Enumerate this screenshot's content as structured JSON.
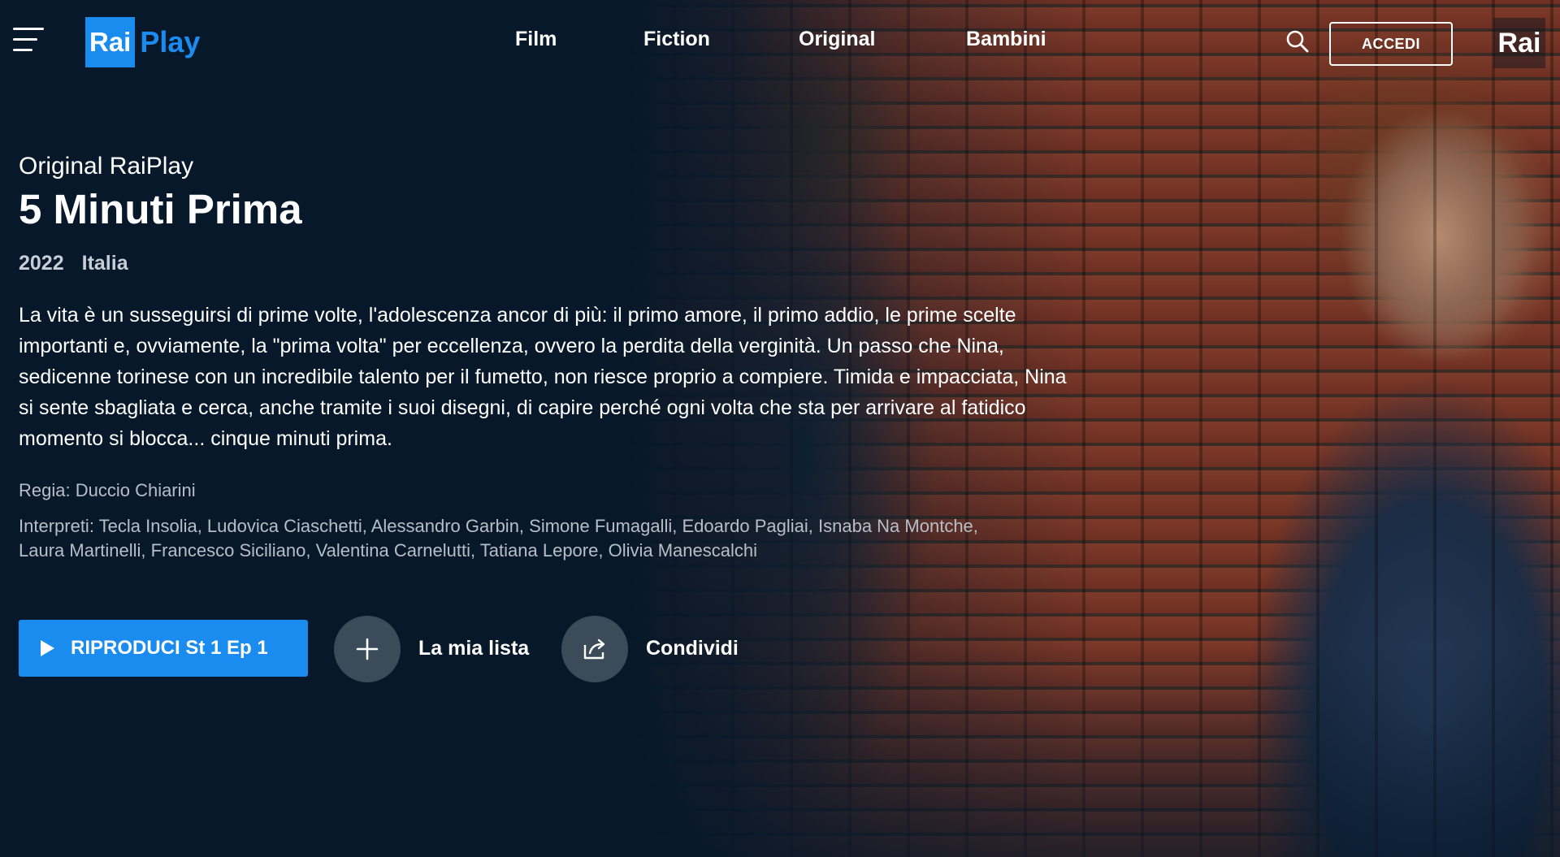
{
  "header": {
    "logo": {
      "rai": "Rai",
      "play": "Play"
    },
    "nav": [
      {
        "label": "Film"
      },
      {
        "label": "Fiction"
      },
      {
        "label": "Original"
      },
      {
        "label": "Bambini"
      }
    ],
    "login_label": "ACCEDI",
    "brand": "Rai",
    "icons": {
      "menu": "hamburger-menu-icon",
      "search": "search-icon"
    }
  },
  "hero": {
    "kicker": "Original RaiPlay",
    "title": "5 Minuti Prima",
    "year": "2022",
    "country": "Italia",
    "description": "La vita è un susseguirsi di prime volte, l'adolescenza ancor di più: il primo amore, il primo addio, le prime scelte importanti e, ovviamente, la \"prima volta\" per eccellenza, ovvero la perdita della verginità. Un passo che Nina, sedicenne torinese con un incredibile talento per il fumetto, non riesce proprio a compiere. Timida e impacciata, Nina si sente sbagliata e cerca, anche tramite i suoi disegni, di capire perché ogni volta che sta per arrivare al fatidico momento si blocca... cinque minuti prima.",
    "director": "Regia: Duccio Chiarini",
    "cast": "Interpreti: Tecla Insolia, Ludovica Ciaschetti, Alessandro Garbin, Simone Fumagalli, Edoardo Pagliai, Isnaba Na Montche, Laura Martinelli, Francesco Siciliano, Valentina Carnelutti, Tatiana Lepore, Olivia Manescalchi"
  },
  "actions": {
    "play_label": "RIPRODUCI St 1 Ep 1",
    "mylist_label": "La mia lista",
    "share_label": "Condividi"
  },
  "colors": {
    "background": "#06182a",
    "accent": "#1a8cf0",
    "circle_button": "#3b4b59"
  }
}
